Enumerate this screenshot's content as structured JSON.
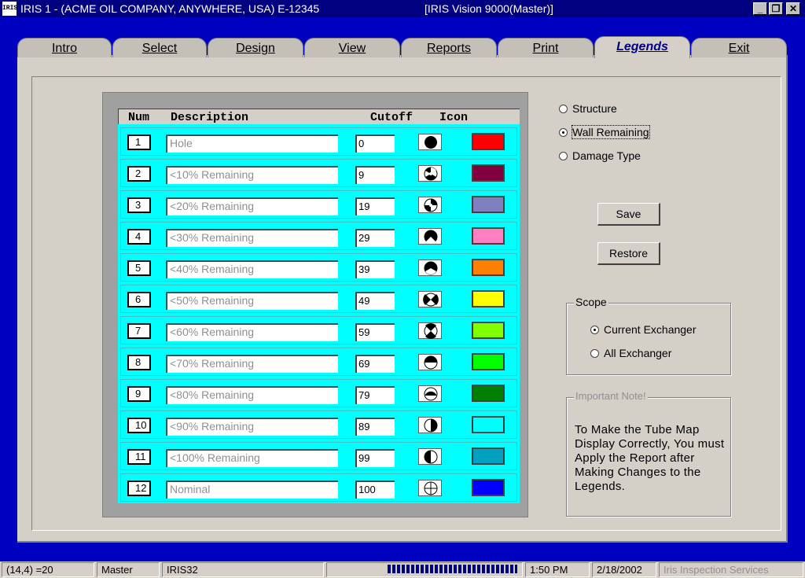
{
  "window": {
    "app_icon": "IRIS",
    "title": "IRIS   1 - (ACME OIL COMPANY, ANYWHERE, USA)  E-12345",
    "center_title": "[IRIS Vision 9000(Master)]",
    "minimize_icon": "minimize-icon",
    "restore_icon": "restore-icon",
    "close_icon": "close-icon"
  },
  "tabs": [
    {
      "label": "Intro"
    },
    {
      "label": "Select"
    },
    {
      "label": "Design"
    },
    {
      "label": "View"
    },
    {
      "label": "Reports"
    },
    {
      "label": "Print"
    },
    {
      "label": "Legends",
      "active": true
    },
    {
      "label": "Exit"
    }
  ],
  "legend": {
    "headers": {
      "num": "Num",
      "description": "Description",
      "cutoff": "Cutoff",
      "icon": "Icon"
    },
    "rows": [
      {
        "num": "1",
        "description": "Hole",
        "cutoff": "0",
        "color": "#ff0000",
        "icon": "full-circle"
      },
      {
        "num": "2",
        "description": "<10% Remaining",
        "cutoff": "9",
        "color": "#800040",
        "icon": "trefoil-3"
      },
      {
        "num": "3",
        "description": "<20% Remaining",
        "cutoff": "19",
        "color": "#8080c0",
        "icon": "trefoil-4"
      },
      {
        "num": "4",
        "description": "<30% Remaining",
        "cutoff": "29",
        "color": "#ff80c0",
        "icon": "wedge-bottom-1"
      },
      {
        "num": "5",
        "description": "<40% Remaining",
        "cutoff": "39",
        "color": "#ff8000",
        "icon": "wedge-bottom-2"
      },
      {
        "num": "6",
        "description": "<50% Remaining",
        "cutoff": "49",
        "color": "#ffff00",
        "icon": "bowtie-h"
      },
      {
        "num": "7",
        "description": "<60% Remaining",
        "cutoff": "59",
        "color": "#80ff00",
        "icon": "hourglass-v"
      },
      {
        "num": "8",
        "description": "<70% Remaining",
        "cutoff": "69",
        "color": "#00ff00",
        "icon": "top-half"
      },
      {
        "num": "9",
        "description": "<80% Remaining",
        "cutoff": "79",
        "color": "#008000",
        "icon": "top-half-small"
      },
      {
        "num": "10",
        "description": "<90% Remaining",
        "cutoff": "89",
        "color": "#00ffff",
        "icon": "right-half"
      },
      {
        "num": "11",
        "description": "<100% Remaining",
        "cutoff": "99",
        "color": "#00a0c0",
        "icon": "left-half"
      },
      {
        "num": "12",
        "description": "Nominal",
        "cutoff": "100",
        "color": "#0000ff",
        "icon": "crosshair"
      }
    ]
  },
  "legend_type": {
    "options": [
      {
        "label": "Structure",
        "selected": false
      },
      {
        "label": "Wall Remaining",
        "selected": true
      },
      {
        "label": "Damage Type",
        "selected": false
      }
    ]
  },
  "buttons": {
    "save": "Save",
    "restore": "Restore"
  },
  "scope": {
    "title": "Scope",
    "options": [
      {
        "label": "Current Exchanger",
        "selected": true
      },
      {
        "label": "All Exchanger",
        "selected": false
      }
    ]
  },
  "note": {
    "title": "Important Note!",
    "text": "To Make the Tube Map Display Correctly, You must Apply the Report after Making Changes to the Legends."
  },
  "statusbar": {
    "coords": "(14,4) =20",
    "user": "Master",
    "app": "IRIS32",
    "time": "1:50 PM",
    "date": "2/18/2002",
    "company": "Iris Inspection Services"
  }
}
